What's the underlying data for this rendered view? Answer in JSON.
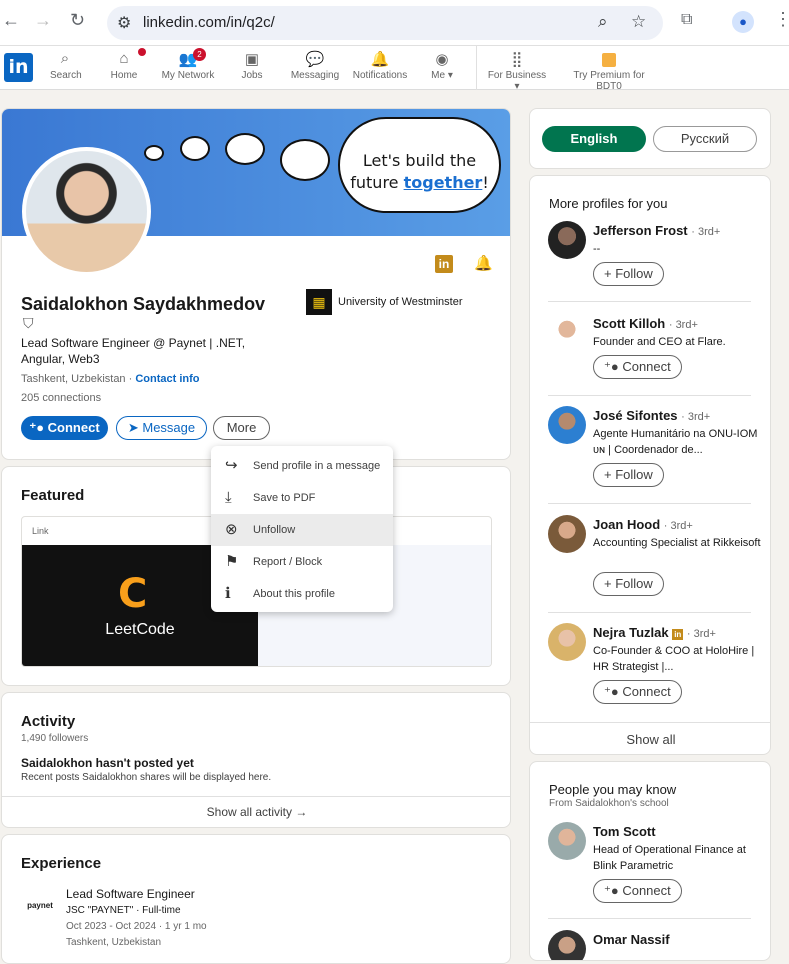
{
  "browser": {
    "url": "linkedin.com/in/q2c/"
  },
  "nav": {
    "logo": "in",
    "items": [
      {
        "label": "Search"
      },
      {
        "label": "Home",
        "badge": ""
      },
      {
        "label": "My Network",
        "badge": "2"
      },
      {
        "label": "Jobs"
      },
      {
        "label": "Messaging"
      },
      {
        "label": "Notifications"
      },
      {
        "label": "Me"
      },
      {
        "label": "For Business"
      },
      {
        "label": "Try Premium for BDT0"
      }
    ]
  },
  "banner": {
    "line1": "Let's build the",
    "line2_a": "future ",
    "line2_b": "together",
    "line2_c": "!"
  },
  "profile": {
    "name": "Saidalokhon Saydakhmedov",
    "headline": "Lead Software Engineer @ Paynet | .NET, Angular, Web3",
    "location": "Tashkent, Uzbekistan",
    "contact": "Contact info",
    "connections": "205 connections",
    "school": "University of Westminster",
    "connect_label": "Connect",
    "message_label": "Message",
    "more_label": "More"
  },
  "more_menu": [
    {
      "label": "Send profile in a message",
      "icon": "share-icon"
    },
    {
      "label": "Save to PDF",
      "icon": "download-icon"
    },
    {
      "label": "Unfollow",
      "icon": "close-circle-icon"
    },
    {
      "label": "Report / Block",
      "icon": "flag-icon"
    },
    {
      "label": "About this profile",
      "icon": "info-icon"
    }
  ],
  "featured": {
    "title": "Featured",
    "link_label": "Link",
    "leetcode": "LeetCode"
  },
  "activity": {
    "title": "Activity",
    "followers": "1,490 followers",
    "empty_title": "Saidalokhon hasn't posted yet",
    "empty_desc": "Recent posts Saidalokhon shares will be displayed here.",
    "show_all": "Show all activity →"
  },
  "experience": {
    "title": "Experience",
    "role": "Lead Software Engineer",
    "company": "JSC \"PAYNET\" · Full-time",
    "dates": "Oct 2023 - Oct 2024 · 1 yr 1 mo",
    "location": "Tashkent, Uzbekistan",
    "logo_text": "paynet"
  },
  "languages": {
    "english": "English",
    "russian": "Русский"
  },
  "more_profiles": {
    "title": "More profiles for you",
    "show_all": "Show all",
    "people": [
      {
        "name": "Jefferson Frost",
        "degree": "· 3rd+",
        "desc": "--",
        "action": "Follow"
      },
      {
        "name": "Scott Killoh",
        "degree": "· 3rd+",
        "desc": "Founder and CEO at Flare.",
        "action": "Connect"
      },
      {
        "name": "José Sifontes",
        "degree": "· 3rd+",
        "desc": "Agente Humanitário na ONU-IOM ᴜɴ | Coordenador de...",
        "action": "Follow"
      },
      {
        "name": "Joan Hood",
        "degree": "· 3rd+",
        "desc": "Accounting Specialist at Rikkeisoft",
        "action": "Follow"
      },
      {
        "name": "Nejra Tuzlak",
        "degree": "· 3rd+",
        "desc": "Co-Founder & COO at HoloHire | HR Strategist |...",
        "action": "Connect"
      }
    ]
  },
  "pymk": {
    "title": "People you may know",
    "subtitle": "From Saidalokhon's school",
    "people": [
      {
        "name": "Tom Scott",
        "desc": "Head of Operational Finance at Blink Parametric",
        "action": "Connect"
      },
      {
        "name": "Omar Nassif"
      }
    ]
  }
}
